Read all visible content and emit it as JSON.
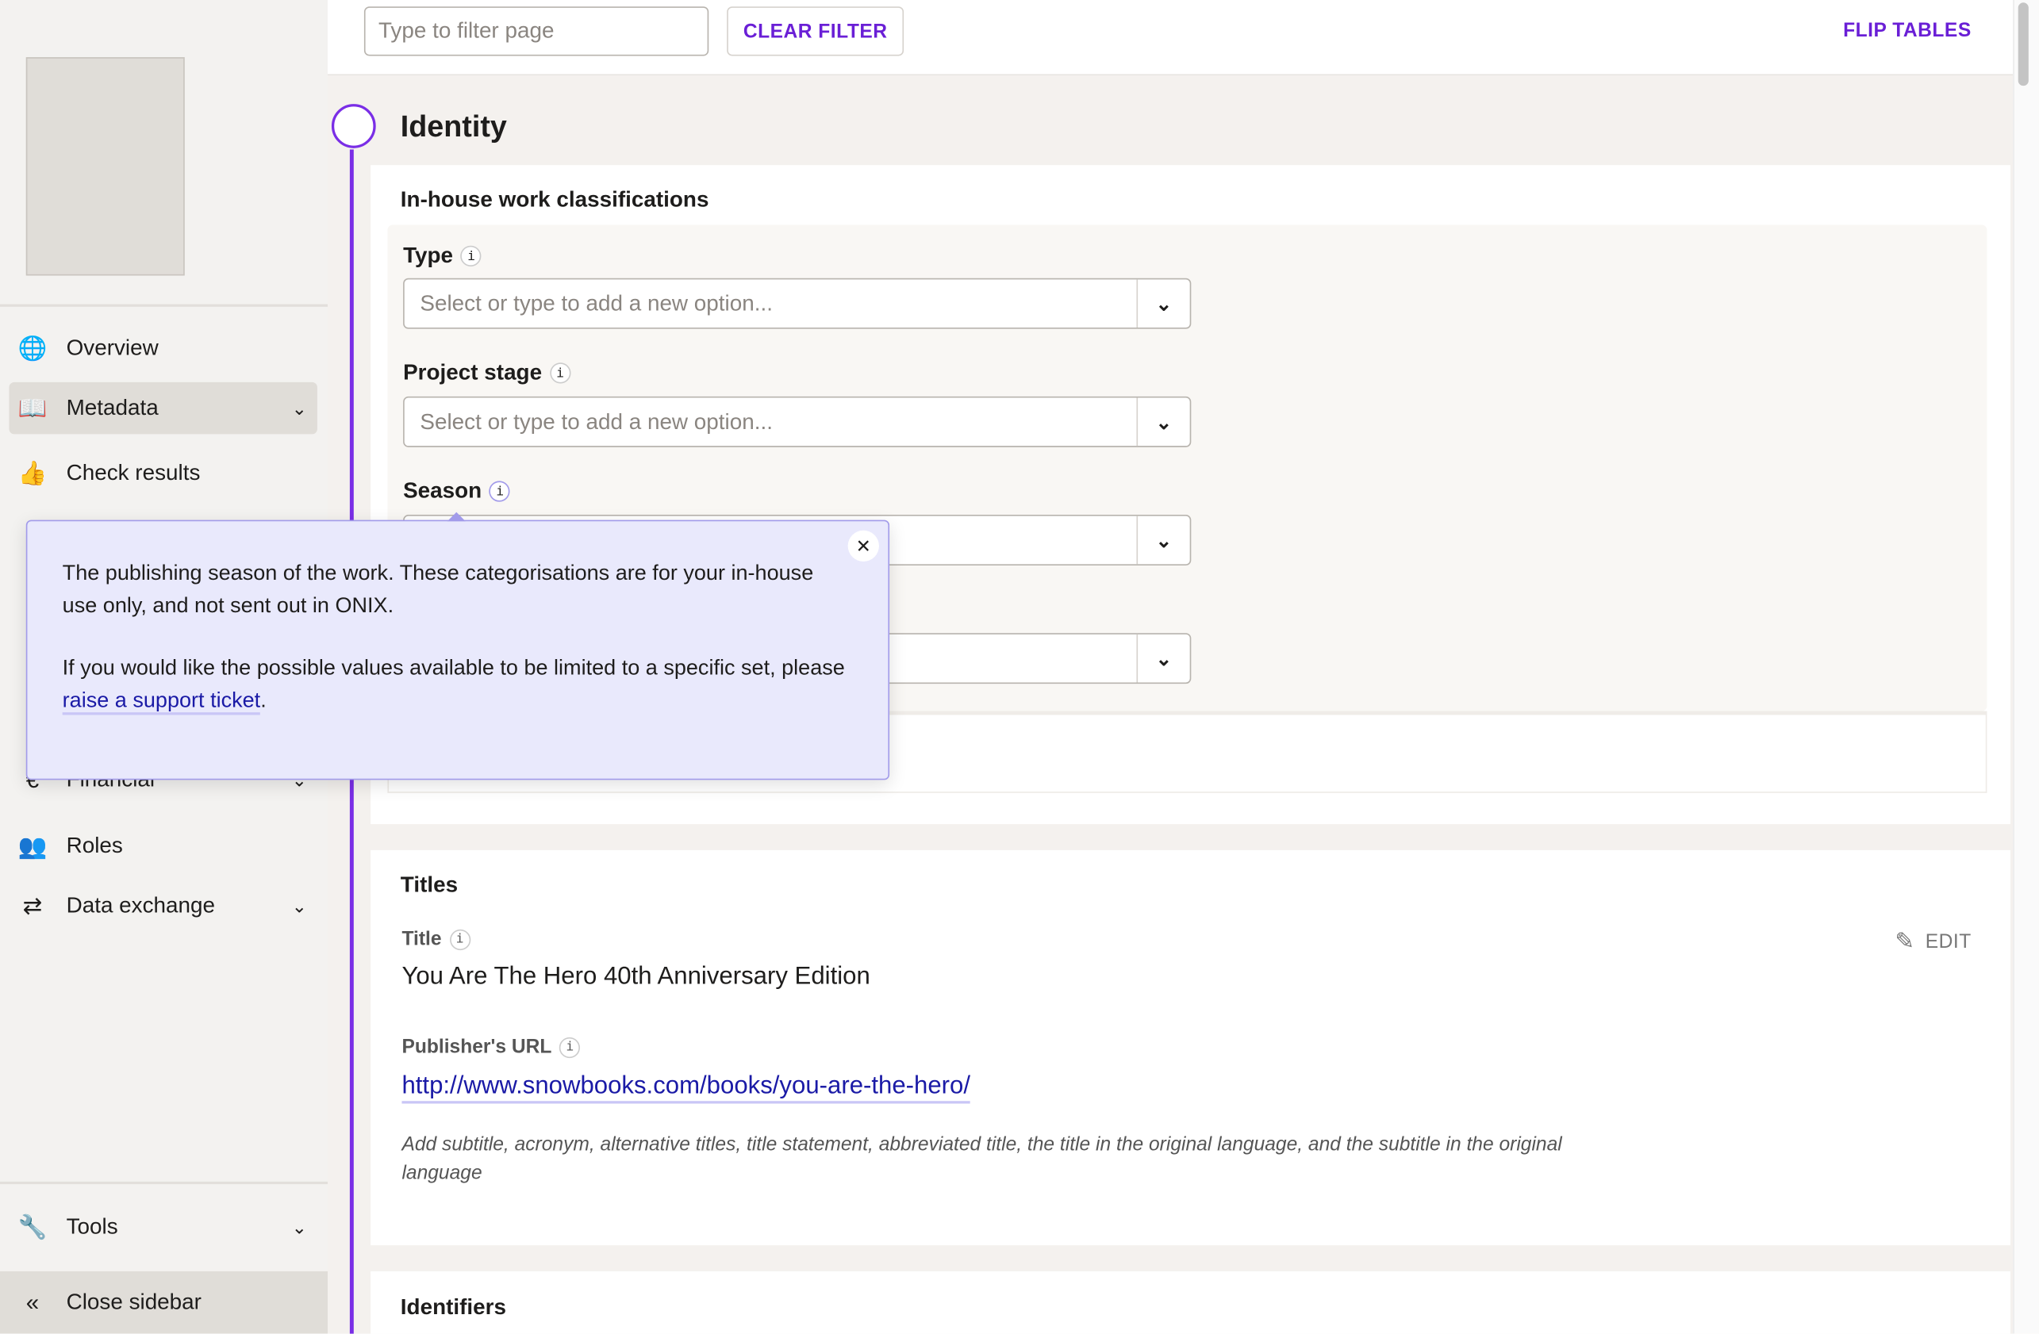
{
  "sidebar": {
    "items": [
      {
        "label": "Overview",
        "icon": "globe-icon",
        "selected": false
      },
      {
        "label": "Metadata",
        "icon": "book-open-icon",
        "selected": true,
        "expandable": true
      },
      {
        "label": "Check results",
        "icon": "thumbs-up-icon",
        "selected": false
      },
      {
        "label": "Financial",
        "icon": "euro-icon",
        "expandable": true
      },
      {
        "label": "Roles",
        "icon": "people-icon"
      },
      {
        "label": "Data exchange",
        "icon": "exchange-icon",
        "expandable": true
      }
    ],
    "tools": "Tools",
    "close": "Close sidebar"
  },
  "topbar": {
    "filter_placeholder": "Type to filter page",
    "clear_filter": "CLEAR FILTER",
    "flip_tables": "FLIP TABLES"
  },
  "identity": {
    "title": "Identity",
    "classifications": {
      "title": "In-house work classifications",
      "fields": [
        {
          "label": "Type",
          "placeholder": "Select or type to add a new option..."
        },
        {
          "label": "Project stage",
          "placeholder": "Select or type to add a new option..."
        },
        {
          "label": "Season",
          "placeholder": ""
        },
        {
          "label": "",
          "placeholder": ""
        }
      ]
    }
  },
  "tooltip": {
    "para1": "The publishing season of the work. These categorisations are for your in-house use only, and not sent out in ONIX.",
    "para2_prefix": "If you would like the possible values available to be limited to a specific set, please ",
    "link": "raise a support ticket",
    "para2_suffix": "."
  },
  "titles": {
    "title": "Titles",
    "title_label": "Title",
    "title_value": "You Are The Hero 40th Anniversary Edition",
    "edit": "EDIT",
    "url_label": "Publisher's URL",
    "url": "http://www.snowbooks.com/books/you-are-the-hero/",
    "note": "Add subtitle, acronym, alternative titles, title statement, abbreviated title, the title in the original language, and the subtitle in the original language"
  },
  "identifiers": {
    "title": "Identifiers"
  },
  "colors": {
    "accent": "#7a2ee6",
    "tooltip_bg": "#e9e9fc",
    "link": "#1a1aa6"
  }
}
